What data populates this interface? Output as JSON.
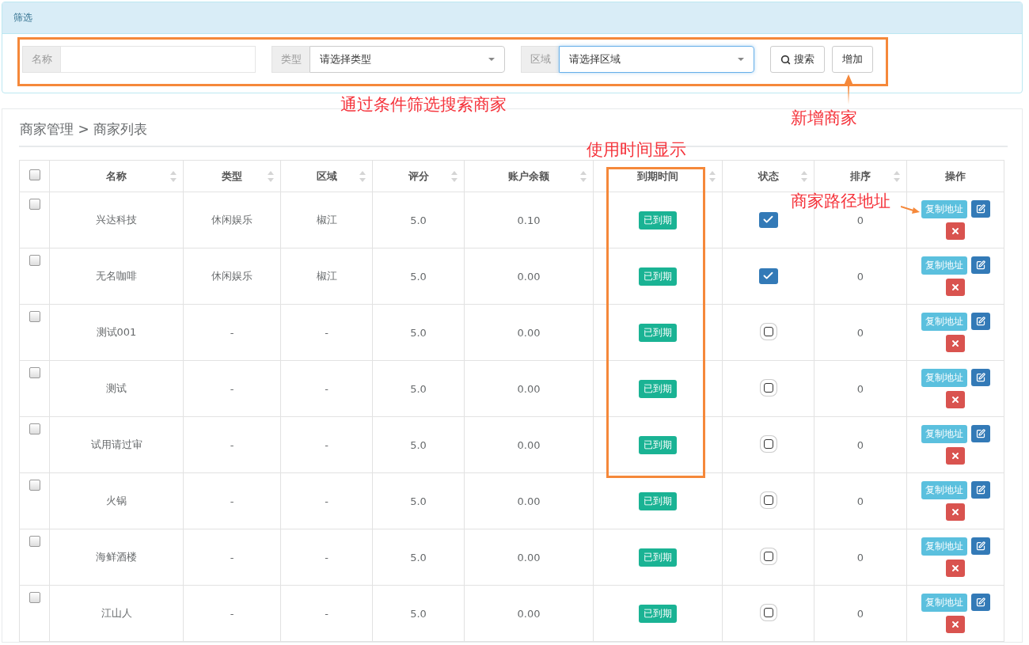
{
  "filter_panel": {
    "title": "筛选",
    "fields": [
      {
        "kind": "text",
        "label": "名称",
        "focused": false
      },
      {
        "kind": "select",
        "label": "类型",
        "value": "请选择类型",
        "focused": false
      },
      {
        "kind": "select",
        "label": "区域",
        "value": "请选择区域",
        "focused": true
      }
    ],
    "buttons": [
      {
        "kind": "search",
        "label": "搜索"
      },
      {
        "kind": "plain",
        "label": "增加"
      }
    ]
  },
  "list_panel": {
    "breadcrumb": "商家管理 > 商家列表",
    "table": {
      "select_all": {
        "checked": false
      },
      "columns": [
        {
          "label": "名称",
          "sortable": true
        },
        {
          "label": "类型",
          "sortable": true
        },
        {
          "label": "区域",
          "sortable": true
        },
        {
          "label": "评分",
          "sortable": true
        },
        {
          "label": "账户余额",
          "sortable": true
        },
        {
          "label": "到期时间",
          "sortable": true
        },
        {
          "label": "状态",
          "sortable": true
        },
        {
          "label": "排序",
          "sortable": true
        },
        {
          "label": "操作",
          "sortable": false
        }
      ],
      "rows": [
        {
          "checked": false,
          "name": "兴达科技",
          "type": "休闲娱乐",
          "area": "椒江",
          "rating": "5.0",
          "balance": "0.10",
          "expiry": "已到期",
          "enabled": true,
          "sort": "0",
          "copy": "复制地址"
        },
        {
          "checked": false,
          "name": "无名咖啡",
          "type": "休闲娱乐",
          "area": "椒江",
          "rating": "5.0",
          "balance": "0.00",
          "expiry": "已到期",
          "enabled": true,
          "sort": "0",
          "copy": "复制地址"
        },
        {
          "checked": false,
          "name": "测试001",
          "type": "-",
          "area": "-",
          "rating": "5.0",
          "balance": "0.00",
          "expiry": "已到期",
          "enabled": false,
          "sort": "0",
          "copy": "复制地址"
        },
        {
          "checked": false,
          "name": "测试",
          "type": "-",
          "area": "-",
          "rating": "5.0",
          "balance": "0.00",
          "expiry": "已到期",
          "enabled": false,
          "sort": "0",
          "copy": "复制地址"
        },
        {
          "checked": false,
          "name": "试用请过审",
          "type": "-",
          "area": "-",
          "rating": "5.0",
          "balance": "0.00",
          "expiry": "已到期",
          "enabled": false,
          "sort": "0",
          "copy": "复制地址"
        },
        {
          "checked": false,
          "name": "火锅",
          "type": "-",
          "area": "-",
          "rating": "5.0",
          "balance": "0.00",
          "expiry": "已到期",
          "enabled": false,
          "sort": "0",
          "copy": "复制地址"
        },
        {
          "checked": false,
          "name": "海鲜酒楼",
          "type": "-",
          "area": "-",
          "rating": "5.0",
          "balance": "0.00",
          "expiry": "已到期",
          "enabled": false,
          "sort": "0",
          "copy": "复制地址"
        },
        {
          "checked": false,
          "name": "江山人",
          "type": "-",
          "area": "-",
          "rating": "5.0",
          "balance": "0.00",
          "expiry": "已到期",
          "enabled": false,
          "sort": "0",
          "copy": "复制地址"
        }
      ]
    }
  },
  "annotations": {
    "notes": [
      "通过条件筛选搜索商家",
      "新增商家",
      "使用时间显示",
      "商家路径地址"
    ]
  }
}
